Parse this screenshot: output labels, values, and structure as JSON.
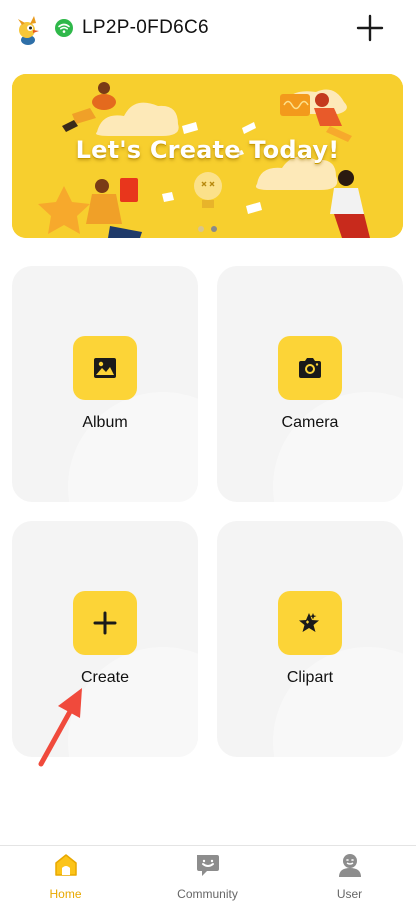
{
  "header": {
    "device_name": "LP2P-0FD6C6",
    "logo_icon": "bird-mascot-icon",
    "connection_icon": "wifi-connected-icon",
    "add_icon": "plus-icon"
  },
  "banner": {
    "title": "Let's Create Today!",
    "page_count": 2,
    "active_page": 2
  },
  "tiles": [
    {
      "label": "Album",
      "icon": "image-icon"
    },
    {
      "label": "Camera",
      "icon": "camera-icon"
    },
    {
      "label": "Create",
      "icon": "plus-icon"
    },
    {
      "label": "Clipart",
      "icon": "star-sticker-icon"
    }
  ],
  "bottom_nav": [
    {
      "label": "Home",
      "icon": "home-icon",
      "active": true
    },
    {
      "label": "Community",
      "icon": "chat-icon",
      "active": false
    },
    {
      "label": "User",
      "icon": "user-icon",
      "active": false
    }
  ],
  "colors": {
    "accent": "#fcd437",
    "banner_bg": "#f7cf2e",
    "tile_bg": "#f4f4f4",
    "nav_active": "#e8a800",
    "connected": "#2fb84a",
    "annotation_arrow": "#f04a3c"
  }
}
